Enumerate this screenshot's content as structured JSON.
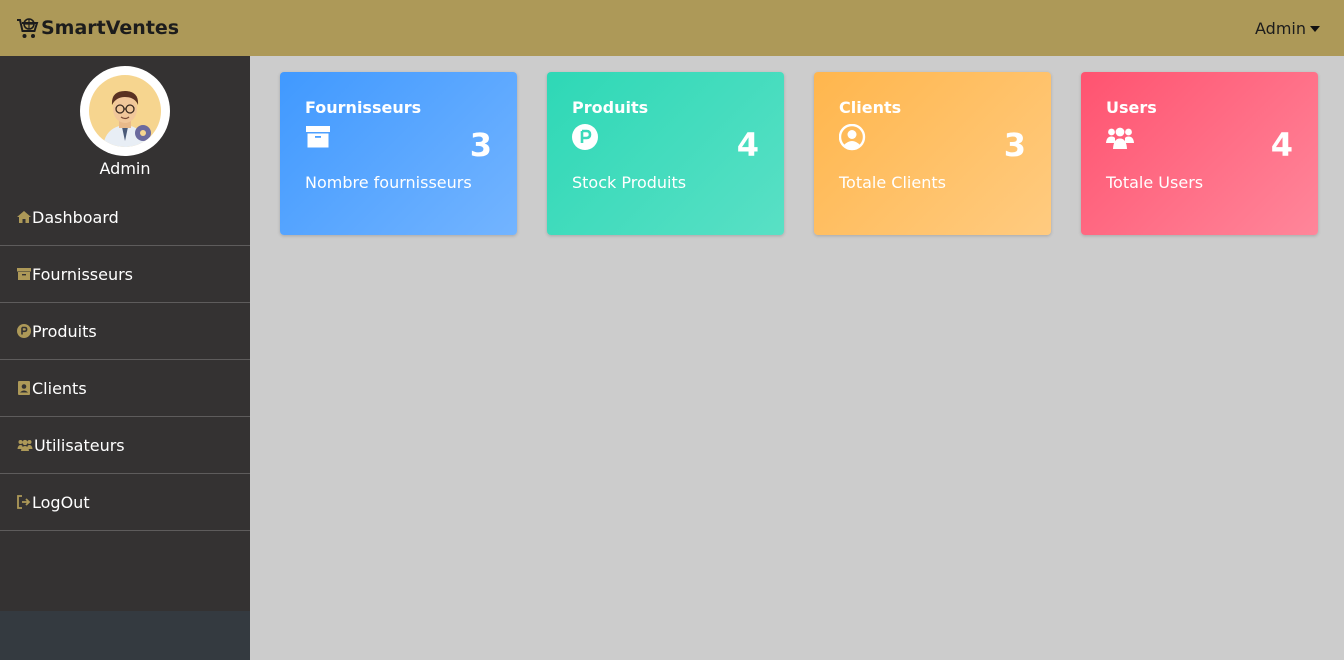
{
  "header": {
    "brand": "SmartVentes",
    "user_menu": "Admin"
  },
  "sidebar": {
    "admin_name": "Admin",
    "items": [
      {
        "label": "Dashboard",
        "icon": "home-icon"
      },
      {
        "label": "Fournisseurs",
        "icon": "archive-icon"
      },
      {
        "label": "Produits",
        "icon": "product-p-icon"
      },
      {
        "label": "Clients",
        "icon": "contact-card-icon"
      },
      {
        "label": "Utilisateurs",
        "icon": "users-icon"
      },
      {
        "label": "LogOut",
        "icon": "logout-icon"
      }
    ]
  },
  "cards": [
    {
      "title": "Fournisseurs",
      "count": "3",
      "subtitle": "Nombre fournisseurs",
      "icon": "archive-icon",
      "color": "#4099ff"
    },
    {
      "title": "Produits",
      "count": "4",
      "subtitle": "Stock Produits",
      "icon": "product-p-icon",
      "color": "#2ed8b6"
    },
    {
      "title": "Clients",
      "count": "3",
      "subtitle": "Totale Clients",
      "icon": "user-circle-icon",
      "color": "#ffb64d"
    },
    {
      "title": "Users",
      "count": "4",
      "subtitle": "Totale Users",
      "icon": "users-icon",
      "color": "#ff5370"
    }
  ],
  "colors": {
    "topbar": "#ad9958",
    "sidebar": "#343232",
    "accent_icon": "#ad9958",
    "content_bg": "#cccccc"
  }
}
